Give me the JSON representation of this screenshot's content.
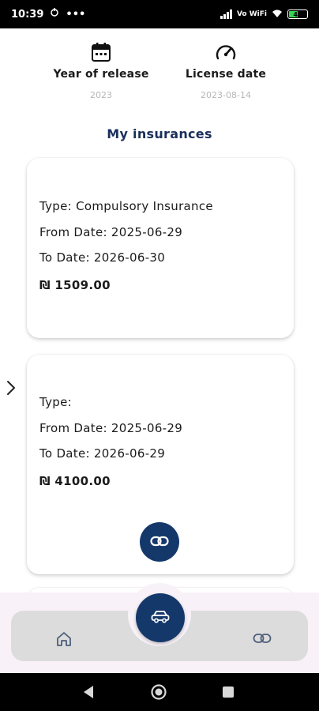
{
  "status_bar": {
    "time": "10:39",
    "network": "Vo WiFi",
    "battery": "44"
  },
  "vehicle": {
    "year_label": "Year of release",
    "year_value": "2023",
    "license_label": "License date",
    "license_value": "2023-08-14"
  },
  "section_title": "My insurances",
  "insurances": [
    {
      "type_line": "Type: Compulsory Insurance",
      "from_line": "From Date: 2025-06-29",
      "to_line": "To Date: 2026-06-30",
      "price": "₪ 1509.00"
    },
    {
      "type_line": "Type:",
      "from_line": "From Date: 2025-06-29",
      "to_line": "To Date: 2026-06-29",
      "price": "₪ 4100.00"
    }
  ],
  "icons": {
    "calendar": "calendar-icon",
    "speedometer": "speedometer-icon",
    "link": "link-icon",
    "car": "car-icon",
    "home": "home-icon",
    "chevron": "chevron-right-icon"
  },
  "colors": {
    "primary": "#15386b",
    "title": "#1a2f5c",
    "nav_bar": "#dcdcdc",
    "bottom_bg": "#f8f2f8"
  }
}
